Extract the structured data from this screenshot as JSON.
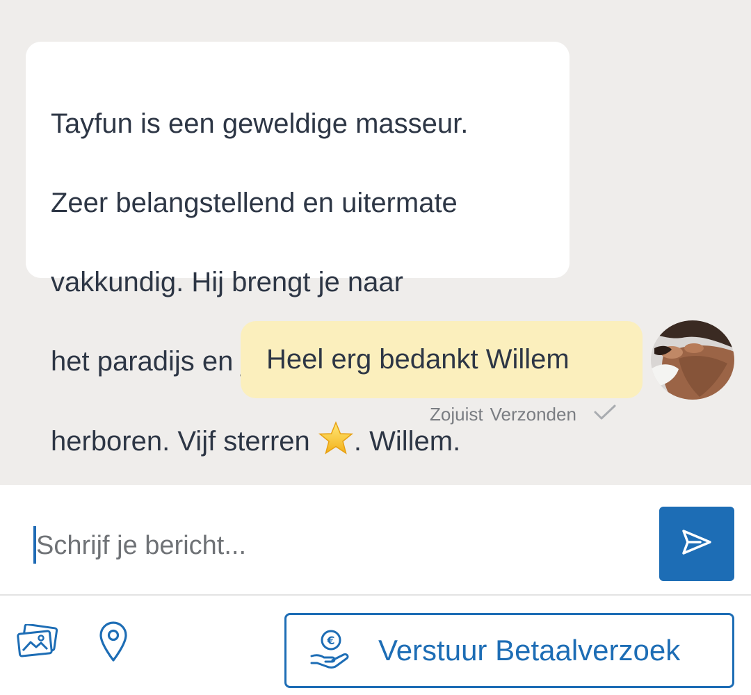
{
  "conversation": {
    "incoming_message": {
      "lines": [
        "Tayfun is een geweldige masseur.",
        "Zeer belangstellend en uitermate",
        "vakkundig. Hij brengt je naar",
        "het paradijs en je voelt je als"
      ],
      "last_line_before_emoji": "herboren. Vijf sterren ",
      "emoji": "star",
      "last_line_after_emoji": ". Willem."
    },
    "outgoing_message": {
      "text": "Heel erg bedankt Willem",
      "time": "Zojuist",
      "status": "Verzonden",
      "status_icon": "checkmark-icon"
    }
  },
  "composer": {
    "placeholder": "Schrijf je bericht...",
    "value": "",
    "send_icon": "send-icon"
  },
  "toolbar": {
    "gallery_icon": "image-gallery-icon",
    "location_icon": "location-pin-icon",
    "payment_request_label": "Verstuur Betaalverzoek",
    "payment_icon": "euro-hand-icon"
  },
  "colors": {
    "accent": "#1d6db5",
    "outgoing_bubble": "#fbefbd",
    "incoming_bubble": "#ffffff",
    "chat_background": "#efedeb",
    "text": "#2d3645"
  }
}
